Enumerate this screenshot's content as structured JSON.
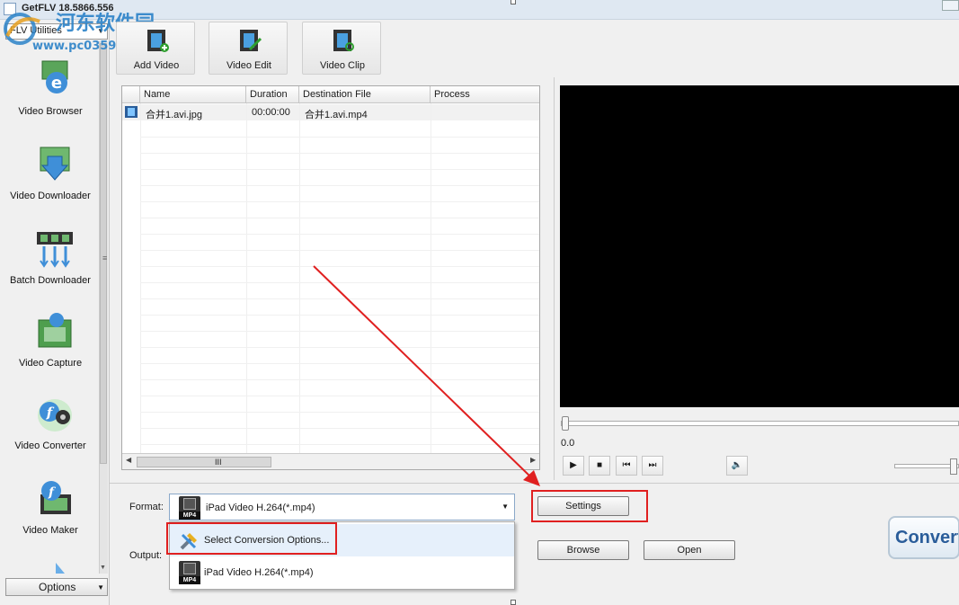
{
  "window": {
    "title": "GetFLV 18.5866.556"
  },
  "watermark": {
    "text": "河东软件园",
    "url": "www.pc0359.cn"
  },
  "sidebar": {
    "category_select": "FLV Utilities",
    "items": [
      {
        "label": "Video Browser",
        "icon": "video-browser-icon"
      },
      {
        "label": "Video Downloader",
        "icon": "video-downloader-icon"
      },
      {
        "label": "Batch Downloader",
        "icon": "batch-downloader-icon"
      },
      {
        "label": "Video Capture",
        "icon": "video-capture-icon"
      },
      {
        "label": "Video Converter",
        "icon": "video-converter-icon"
      },
      {
        "label": "Video Maker",
        "icon": "video-maker-icon"
      }
    ],
    "options_label": "Options"
  },
  "toolbar": {
    "buttons": [
      {
        "label": "Add Video",
        "icon": "add-video-icon"
      },
      {
        "label": "Video Edit",
        "icon": "video-edit-icon"
      },
      {
        "label": "Video Clip",
        "icon": "video-clip-icon"
      }
    ]
  },
  "file_list": {
    "columns": [
      "Name",
      "Duration",
      "Destination File",
      "Process"
    ],
    "rows": [
      {
        "name": "合并1.avi.jpg",
        "duration": "00:00:00",
        "destination": "合并1.avi.mp4",
        "process": ""
      }
    ],
    "scroll_grip": "III"
  },
  "player": {
    "time": "0.0",
    "controls": {
      "play": "▶",
      "stop": "■",
      "prev": "⏮",
      "next": "⏭",
      "mute": "🔈"
    },
    "seek_position": 0,
    "volume": 1.0
  },
  "conversion": {
    "format_label": "Format:",
    "output_label": "Output:",
    "format_value": "iPad Video H.264(*.mp4)",
    "dropdown_options": [
      "Select Conversion Options...",
      "iPad Video H.264(*.mp4)"
    ],
    "mp4_badge": "MP4",
    "settings_label": "Settings",
    "browse_label": "Browse",
    "open_label": "Open",
    "convert_label": "Convert"
  },
  "colors": {
    "highlight": "#e02020",
    "accent": "#2a5d9a",
    "video_bg": "#000000"
  }
}
